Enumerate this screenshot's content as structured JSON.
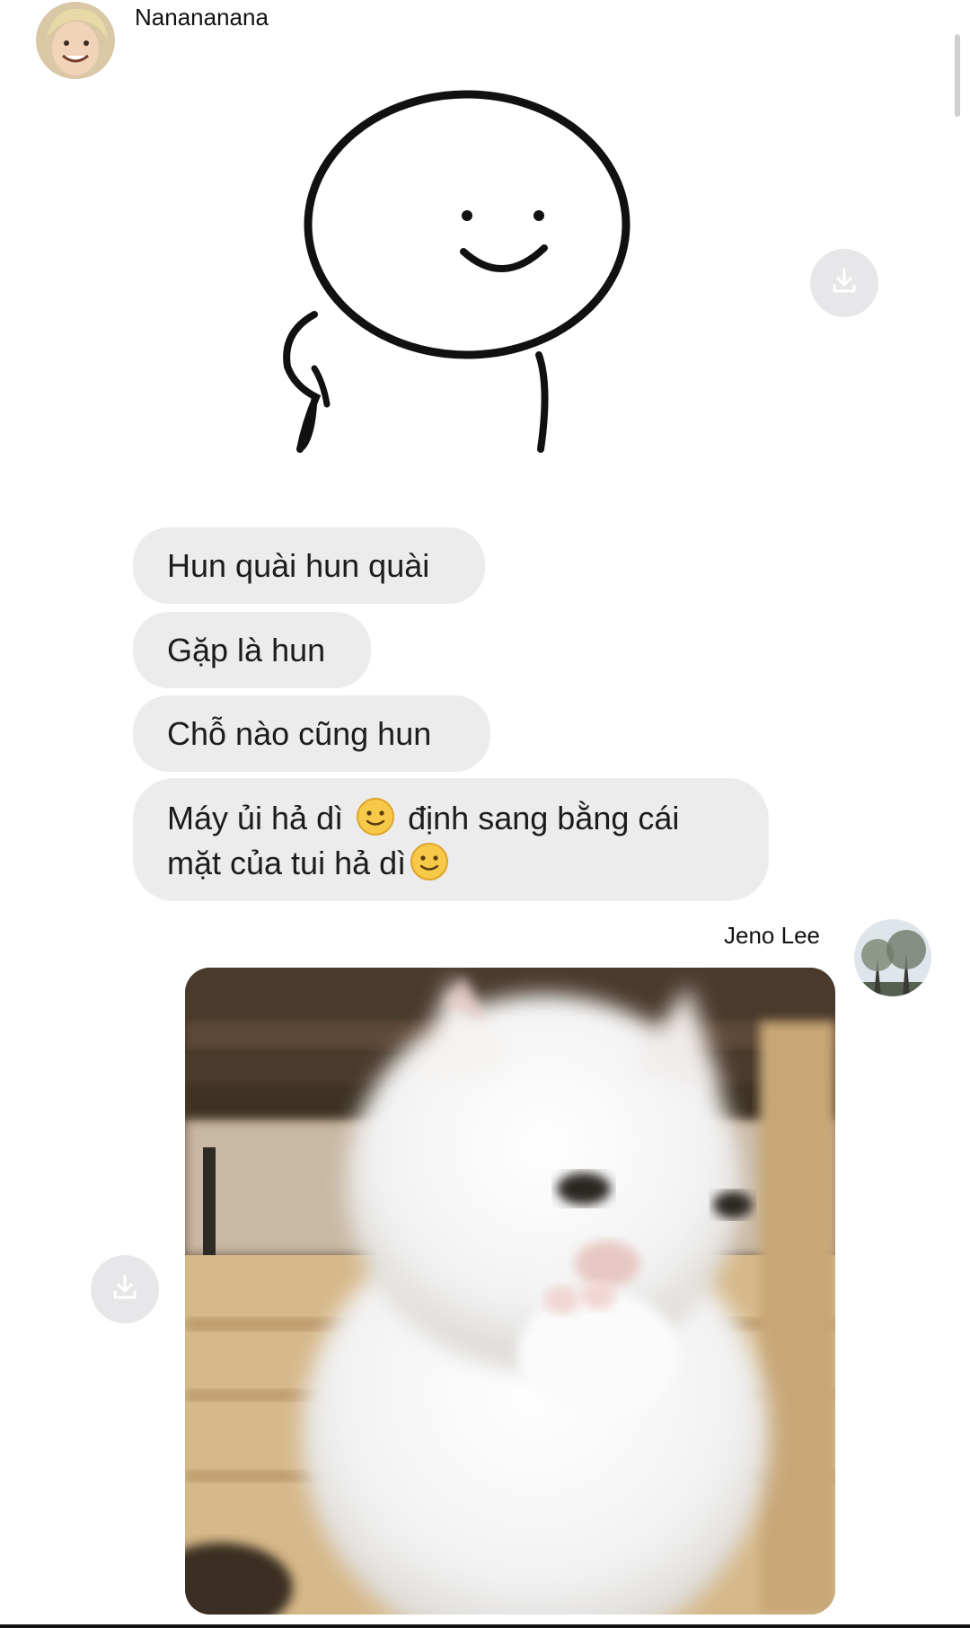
{
  "thread": {
    "first_sender": {
      "name": "Nanananana"
    },
    "messages": [
      {
        "text": "Hun quài hun quài"
      },
      {
        "text": "Gặp là hun"
      },
      {
        "text": "Chỗ nào cũng hun"
      },
      {
        "line1_a": "Máy ủi hả dì",
        "line1_b": "định sang bằng cái",
        "line2": "mặt của tui hả dì"
      }
    ],
    "second_sender": {
      "name": "Jeno Lee"
    }
  },
  "icons": {
    "download": "download-icon",
    "emoji": "slightly-smiling-face-emoji"
  },
  "colors": {
    "bubble_bg": "#ececed",
    "download_bg": "#e7e7ea"
  }
}
